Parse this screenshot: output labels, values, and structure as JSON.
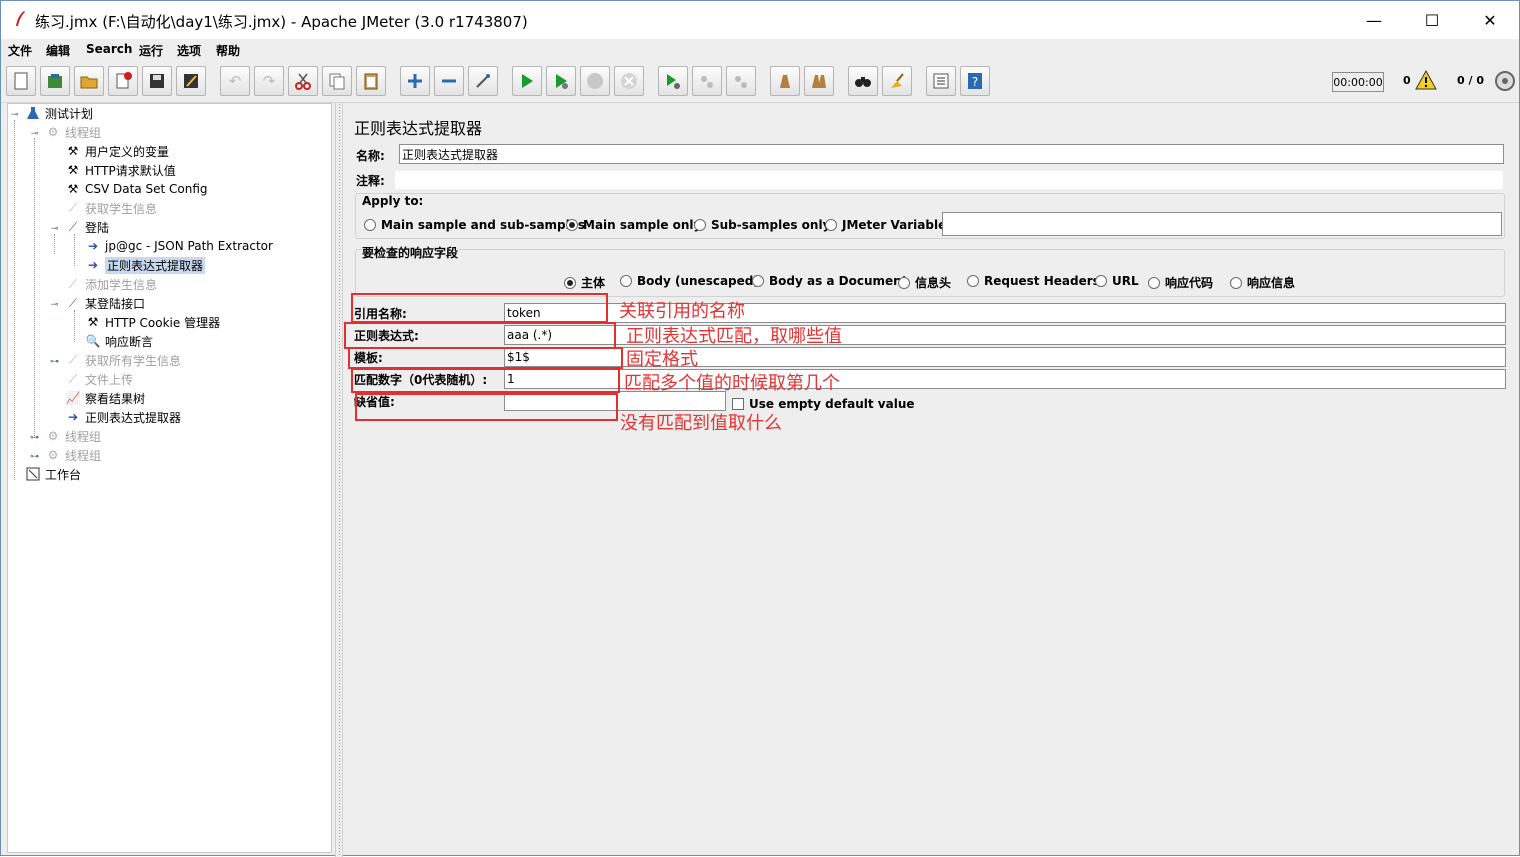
{
  "window": {
    "title": "练习.jmx (F:\\自动化\\day1\\练习.jmx) - Apache JMeter (3.0 r1743807)",
    "minimize": "—",
    "maximize": "☐",
    "close": "✕"
  },
  "menubar": [
    "文件",
    "编辑",
    "Search",
    "运行",
    "选项",
    "帮助"
  ],
  "toolbar": {
    "timer": "00:00:00",
    "warning_count": "0",
    "thread_count": "0 / 0"
  },
  "tree": {
    "test_plan": "测试计划",
    "thread_group": "线程组",
    "user_vars": "用户定义的变量",
    "http_defaults": "HTTP请求默认值",
    "csv_config": "CSV Data Set Config",
    "get_student": "获取学生信息",
    "login": "登陆",
    "json_extractor": "jp@gc - JSON Path Extractor",
    "regex_extractor": "正则表达式提取器",
    "add_student": "添加学生信息",
    "some_login": "某登陆接口",
    "cookie_mgr": "HTTP Cookie 管理器",
    "assertion": "响应断言",
    "get_all": "获取所有学生信息",
    "upload": "文件上传",
    "results_tree": "察看结果树",
    "regex_extractor2": "正则表达式提取器",
    "thread_group2": "线程组",
    "thread_group3": "线程组",
    "workbench": "工作台"
  },
  "panel": {
    "title": "正则表达式提取器",
    "name_label": "名称:",
    "name_value": "正则表达式提取器",
    "comment_label": "注释:",
    "apply_to_label": "Apply to:",
    "apply_options": [
      "Main sample and sub-samples",
      "Main sample only",
      "Sub-samples only",
      "JMeter Variable"
    ],
    "field_group_label": "要检查的响应字段",
    "field_options": [
      "主体",
      "Body (unescaped)",
      "Body as a Document",
      "信息头",
      "Request Headers",
      "URL",
      "响应代码",
      "响应信息"
    ],
    "ref_name_label": "引用名称:",
    "ref_name_value": "token",
    "regex_label": "正则表达式:",
    "regex_value": "aaa (.*)",
    "template_label": "模板:",
    "template_value": "$1$",
    "match_no_label": "匹配数字（0代表随机）:",
    "match_no_value": "1",
    "default_label": "缺省值:",
    "default_value": "",
    "use_empty_label": "Use empty default value"
  },
  "annotations": {
    "ref_name": "关联引用的名称",
    "regex": "正则表达式匹配，取哪些值",
    "template": "固定格式",
    "match_no": "匹配多个值的时候取第几个",
    "default": "没有匹配到值取什么"
  },
  "colors": {
    "annotation": "#e53333",
    "selection": "#c8d8ee",
    "background": "#eeeeee"
  }
}
